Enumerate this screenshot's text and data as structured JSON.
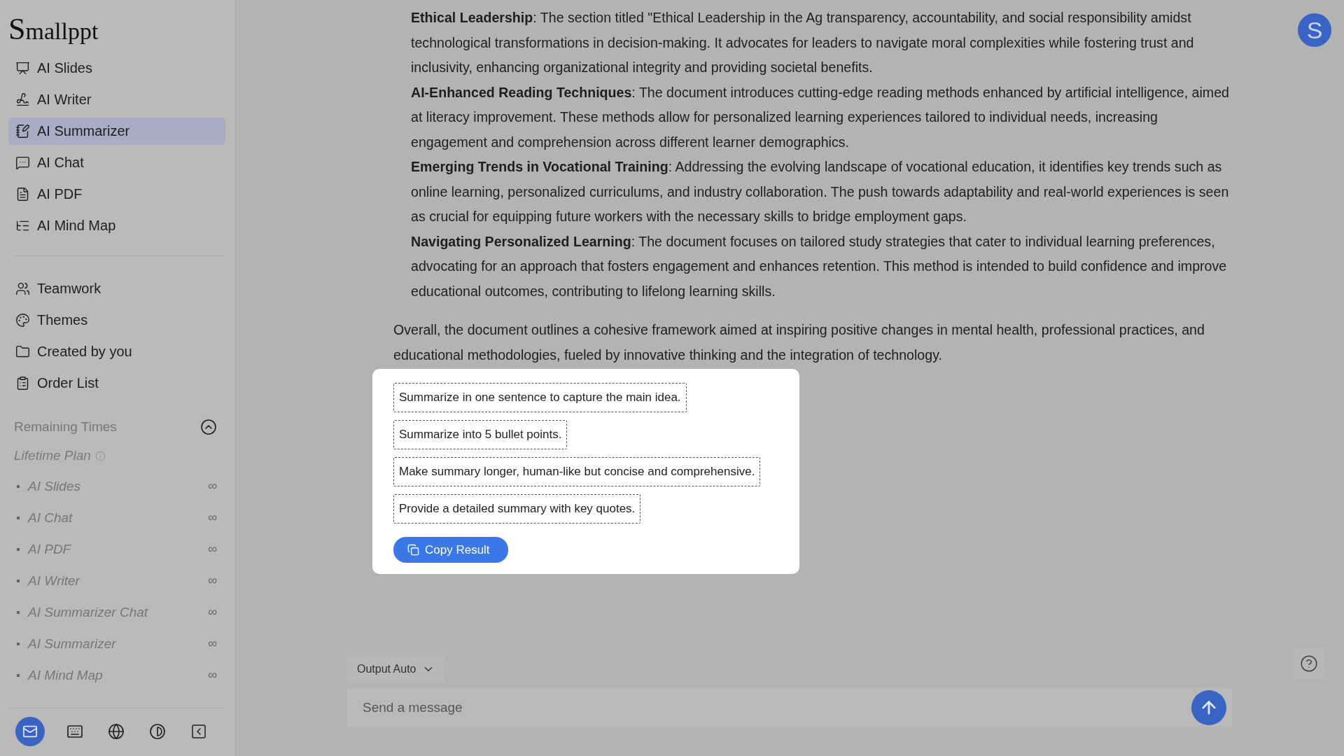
{
  "logo": "Smallppt",
  "nav": [
    {
      "label": "AI Slides",
      "selected": false
    },
    {
      "label": "AI Writer",
      "selected": false
    },
    {
      "label": "AI Summarizer",
      "selected": true
    },
    {
      "label": "AI Chat",
      "selected": false
    },
    {
      "label": "AI PDF",
      "selected": false
    },
    {
      "label": "AI Mind Map",
      "selected": false
    }
  ],
  "nav_secondary": [
    {
      "label": "Teamwork"
    },
    {
      "label": "Themes"
    },
    {
      "label": "Created by you"
    },
    {
      "label": "Order List"
    }
  ],
  "remaining": {
    "title": "Remaining Times",
    "plan": "Lifetime Plan",
    "items": [
      {
        "label": "AI Slides",
        "value": "∞"
      },
      {
        "label": "AI Chat",
        "value": "∞"
      },
      {
        "label": "AI PDF",
        "value": "∞"
      },
      {
        "label": "AI Writer",
        "value": "∞"
      },
      {
        "label": "AI Summarizer Chat",
        "value": "∞"
      },
      {
        "label": "AI Summarizer",
        "value": "∞"
      },
      {
        "label": "AI Mind Map",
        "value": "∞"
      }
    ]
  },
  "summary_points": [
    "**Ethical Leadership**: The section titled \"Ethical Leadership in the Ag transparency, accountability, and social responsibility amidst technological transformations in decision-making. It advocates for leaders to navigate moral complexities while fostering trust and inclusivity, enhancing organizational integrity and providing societal benefits.",
    "**AI-Enhanced Reading Techniques**: The document introduces cutting-edge reading methods enhanced by artificial intelligence, aimed at literacy improvement. These methods allow for personalized learning experiences tailored to individual needs, increasing engagement and comprehension across different learner demographics.",
    "**Emerging Trends in Vocational Training**: Addressing the evolving landscape of vocational education, it identifies key trends such as online learning, personalized curriculums, and industry collaboration. The push towards adaptability and real-world experiences is seen as crucial for equipping future workers with the necessary skills to bridge employment gaps.",
    "**Navigating Personalized Learning**: The document focuses on tailored study strategies that cater to individual learning preferences, advocating for an approach that fosters engagement and enhances retention. This method is intended to build confidence and improve educational outcomes, contributing to lifelong learning skills."
  ],
  "summary_conclusion": "Overall, the document outlines a cohesive framework aimed at inspiring positive changes in mental health, professional practices, and educational methodologies, fueled by innovative thinking and the integration of technology.",
  "popup": {
    "options": [
      "Summarize in one sentence to capture the main idea.",
      "Summarize into 5 bullet points.",
      "Make summary longer, human-like but concise and comprehensive.",
      "Provide a detailed summary with key quotes."
    ],
    "copy_button": "Copy Result"
  },
  "composer": {
    "output_mode": "Output Auto",
    "placeholder": "Send a message"
  },
  "avatar_letter": "S"
}
